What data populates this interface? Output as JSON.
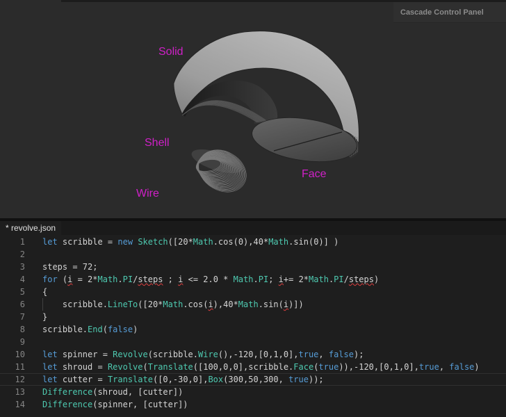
{
  "panel": {
    "title": "Cascade Control Panel"
  },
  "scene": {
    "labels": {
      "solid": "Solid",
      "shell": "Shell",
      "wire": "Wire",
      "face": "Face"
    },
    "label_color": "#d020c8"
  },
  "editor": {
    "tab_label": "* revolve.json",
    "lines": [
      {
        "n": "1",
        "html": "<span class='k'>let</span> scribble = <span class='k'>new</span> <span class='f'>Sketch</span>([20*<span class='m'>Math</span>.cos(0),40*<span class='m'>Math</span>.sin(0)] )"
      },
      {
        "n": "2",
        "html": ""
      },
      {
        "n": "3",
        "html": "steps = 72;"
      },
      {
        "n": "4",
        "html": "<span class='k'>for</span> (<span class='squig'>i</span> = 2*<span class='m'>Math</span>.<span class='m'>PI</span>/<span class='squig'>steps</span> ; <span class='squig'>i</span> &lt;= 2.0 * <span class='m'>Math</span>.<span class='m'>PI</span>; <span class='squig'>i</span>+= 2*<span class='m'>Math</span>.<span class='m'>PI</span>/<span class='squig'>steps</span>)"
      },
      {
        "n": "5",
        "html": "{"
      },
      {
        "n": "6",
        "html": "    scribble.<span class='f'>LineTo</span>([20*<span class='m'>Math</span>.cos(<span class='squig'>i</span>),40*<span class='m'>Math</span>.sin(<span class='squig'>i</span>)])",
        "guide": true
      },
      {
        "n": "7",
        "html": "}"
      },
      {
        "n": "8",
        "html": "scribble.<span class='f'>End</span>(<span class='k'>false</span>)"
      },
      {
        "n": "9",
        "html": ""
      },
      {
        "n": "10",
        "html": "<span class='k'>let</span> spinner = <span class='f'>Revolve</span>(scribble.<span class='f'>Wire</span>(),-120,[0,1,0],<span class='k'>true</span>, <span class='k'>false</span>);"
      },
      {
        "n": "11",
        "html": "<span class='k'>let</span> shroud = <span class='f'>Revolve</span>(<span class='f'>Translate</span>([100,0,0],scribble.<span class='f'>Face</span>(<span class='k'>true</span>)),-120,[0,1,0],<span class='k'>true</span>, <span class='k'>false</span>)"
      },
      {
        "n": "12",
        "html": "<span class='k'>let</span> cutter = <span class='f'>Translate</span>([0,-30,0],<span class='f'>Box</span>(300,50,300, <span class='k'>true</span>));",
        "current": true
      },
      {
        "n": "13",
        "html": "<span class='f'>Difference</span>(shroud, [cutter])"
      },
      {
        "n": "14",
        "html": "<span class='f'>Difference</span>(spinner, [cutter])"
      }
    ]
  },
  "colors": {
    "keyword": "#569cd6",
    "function": "#4ec9b0",
    "text": "#d4d4d4",
    "background": "#1e1e1e"
  }
}
